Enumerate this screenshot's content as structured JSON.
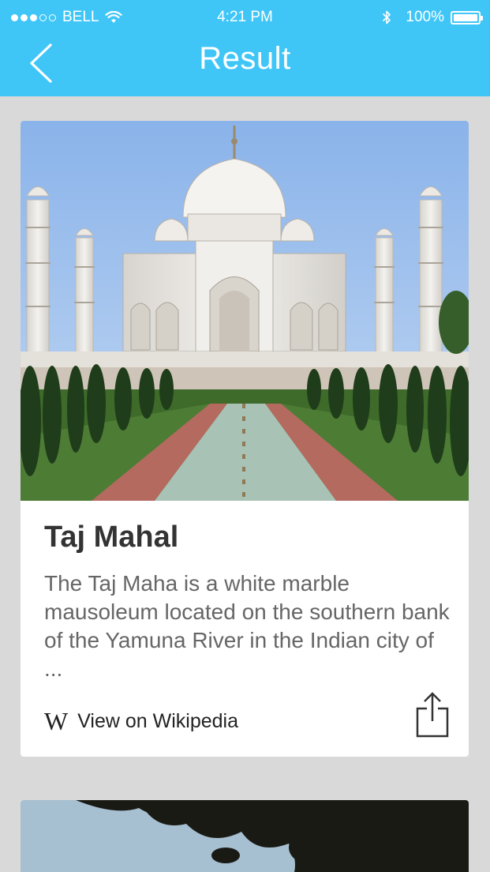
{
  "status_bar": {
    "carrier": "BELL",
    "time": "4:21 PM",
    "battery": "100%",
    "signal_bars_filled": 3,
    "signal_bars_total": 5
  },
  "nav": {
    "title": "Result",
    "back_icon": "chevron-left-icon"
  },
  "card": {
    "title": "Taj Mahal",
    "description": "The Taj Maha is a white marble mausoleum located on the southern bank of the Yamuna River in the Indian city of ...",
    "link_icon_glyph": "W",
    "link_label": "View on Wikipedia",
    "share_icon": "share-icon"
  },
  "colors": {
    "header": "#3fc6f7",
    "background": "#d9d9d9",
    "card": "#ffffff",
    "title_text": "#333333",
    "body_text": "#666666"
  }
}
